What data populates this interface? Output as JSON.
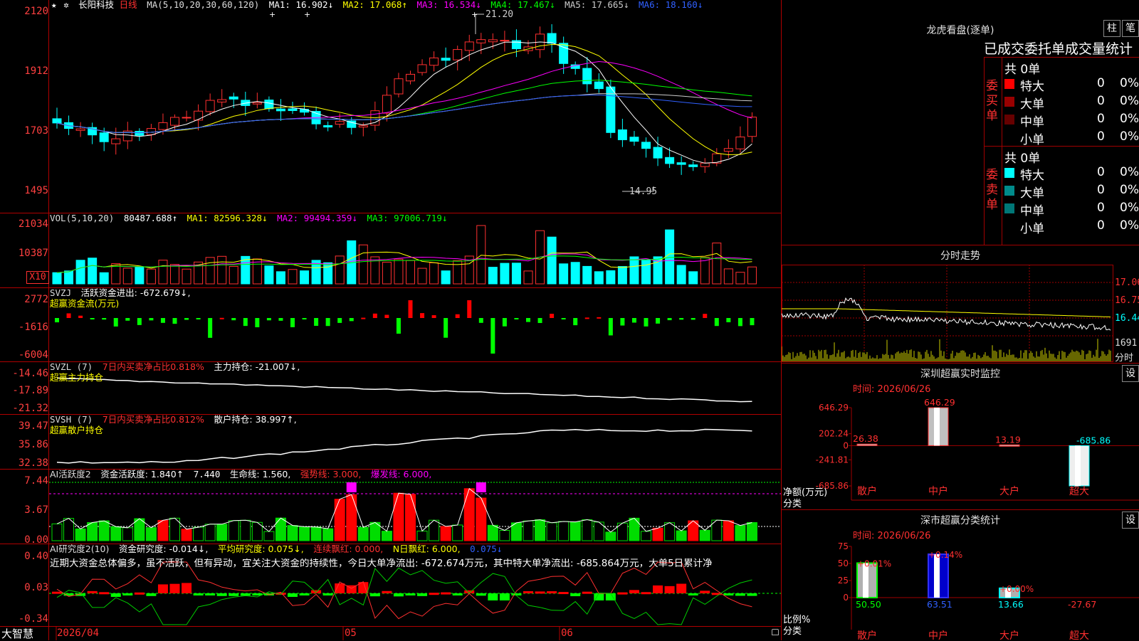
{
  "header": {
    "star": "★",
    "gear": "✲",
    "stock_name": "长阳科技",
    "period": "日线",
    "ma_label": "MA(5,10,20,30,60,120)",
    "ma1": "MA1: 16.902↓",
    "ma2": "MA2: 17.068↑",
    "ma3": "MA3: 16.534↓",
    "ma4": "MA4: 17.467↓",
    "ma5": "MA5: 17.665↓",
    "ma6": "MA6: 18.160↓"
  },
  "price_axis": [
    "2120",
    "1912",
    "1703",
    "1495"
  ],
  "price_annotations": {
    "high": "21.20",
    "low": "14.95"
  },
  "vol": {
    "label": "VOL(5,10,20)",
    "value": "80487.688↑",
    "ma1": "MA1: 82596.328↓",
    "ma2": "MA2: 99494.359↓",
    "ma3": "MA3: 97006.719↓",
    "axis": [
      "21034",
      "10387"
    ],
    "unit": "X10"
  },
  "svzj": {
    "label": "SVZJ",
    "text": "活跃资金进出: -672.679↓,",
    "title": "超赢资金流(万元)",
    "axis": [
      "2772",
      "-1616",
      "-6004"
    ]
  },
  "svzl": {
    "label": "SVZL (7)",
    "text1": "7日内买卖净占比0.818%",
    "text2": "主力持仓: -21.007↓,",
    "title": "超赢主力持仓",
    "axis": [
      "-14.46",
      "-17.89",
      "-21.32"
    ]
  },
  "svsh": {
    "label": "SVSH (7)",
    "text1": "7日内买卖净占比0.812%",
    "text2": "散户持仓: 38.997↑,",
    "title": "超赢散户持仓",
    "axis": [
      "39.47",
      "35.86",
      "32.38"
    ]
  },
  "ai_active": {
    "label": "AI活跃度2",
    "t1": "资金活跃度: 1.840↑",
    "t2": "7.440",
    "t3": "生命线: 1.560,",
    "t4": "强势线: 3.000,",
    "t5": "爆发线: 6.000,",
    "axis": [
      "7.44",
      "3.67",
      "0.00"
    ]
  },
  "ai_research": {
    "label": "AI研究度2(10)",
    "t1": "资金研究度: -0.014↓,",
    "t2": "平均研究度: 0.075↓,",
    "t3": "连续飘红: 0.000,",
    "t4": "N日飘红: 6.000,",
    "t5": "0.075↓",
    "desc": "近期大资金总体偏多，虽不活跃，但有异动，宜关注大资金的持续性，今日大单净流出: -672.674万元，其中特大单净流出: -685.864万元，大单5日累计净",
    "axis": [
      "0.40",
      "0.03",
      "-0.34"
    ]
  },
  "bottom": {
    "logo": "大智慧",
    "date": "2026/04",
    "m05": "05",
    "m06": "06"
  },
  "dragon_tiger": {
    "title": "龙虎看盘(逐单)",
    "btn1": "柱",
    "btn2": "笔",
    "subtitle": "已成交委托单成交量统计",
    "buy_label": "委买单",
    "sell_label": "委卖单",
    "buy_total": "共 0单",
    "sell_total": "共 0单",
    "buy_rows": [
      {
        "label": "特大",
        "count": "0",
        "pct": "0%",
        "color": "#ff0000"
      },
      {
        "label": "大单",
        "count": "0",
        "pct": "0%",
        "color": "#990000"
      },
      {
        "label": "中单",
        "count": "0",
        "pct": "0%",
        "color": "#660000"
      },
      {
        "label": "小单",
        "count": "0",
        "pct": "0%",
        "color": ""
      }
    ],
    "sell_rows": [
      {
        "label": "特大",
        "count": "0",
        "pct": "0%",
        "color": "#00ffff"
      },
      {
        "label": "大单",
        "count": "0",
        "pct": "0%",
        "color": "#008b8b"
      },
      {
        "label": "中单",
        "count": "0",
        "pct": "0%",
        "color": "#007777"
      },
      {
        "label": "小单",
        "count": "0",
        "pct": "0%",
        "color": ""
      }
    ]
  },
  "intraday": {
    "title": "分时走势",
    "axis": [
      "17.06",
      "16.75",
      "16.44",
      "1691"
    ],
    "footer": "分时"
  },
  "sz_monitor": {
    "title": "深圳超赢实时监控",
    "btn": "设",
    "time": "时间: 2026/06/26",
    "ylabel": "净额(万元)",
    "xlabel": "分类",
    "axis": [
      "646.29",
      "202.24",
      "0",
      "-241.81",
      "-685.86"
    ],
    "chart_data": {
      "type": "bar",
      "categories": [
        "散户",
        "中户",
        "大户",
        "超大"
      ],
      "values": [
        26.38,
        646.29,
        13.19,
        -685.86
      ],
      "labels": [
        "26.38",
        "646.29",
        "13.19",
        "-685.86"
      ],
      "ylim": [
        -685.86,
        646.29
      ]
    }
  },
  "sz_class": {
    "title": "深市超赢分类统计",
    "btn": "设",
    "time": "时间: 2026/06/26",
    "ylabel": "比例%",
    "xlabel": "分类",
    "axis": [
      "75",
      "50",
      "25",
      "0"
    ],
    "chart_data": {
      "type": "bar",
      "categories": [
        "散户",
        "中户",
        "大户",
        "超大"
      ],
      "values": [
        50.5,
        63.51,
        13.66,
        -27.67
      ],
      "labels": [
        "50.50",
        "63.51",
        "13.66",
        "-27.67"
      ],
      "changes": [
        "+0.01%",
        "+0.14%",
        "+0.00%",
        ""
      ],
      "ylim": [
        0,
        75
      ]
    }
  }
}
